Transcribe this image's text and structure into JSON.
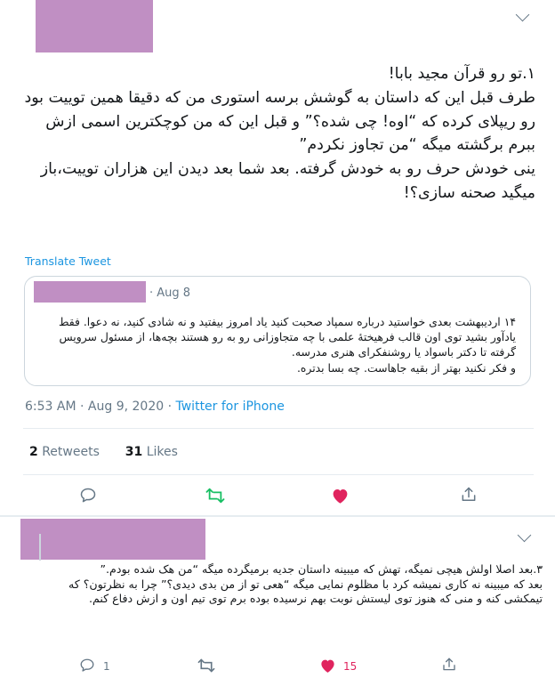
{
  "tweet": {
    "text": "١.تو رو قرآن مجید بابا!\nطرف قبل این که داستان به گوشش برسه استوری من که دقیقا همین توییت بود رو ریپلای کرده که “اوه! چی شده؟” و قبل این که من کوچکترین اسمی ازش ببرم برگشته میگه “من تجاوز نکردم”\nینی خودش حرف رو به خودش گرفته. بعد شما بعد دیدن این هزاران توییت،باز میگید صحنه سازی؟!",
    "translate_label": "Translate Tweet",
    "time": "6:53 AM",
    "date": "Aug 9, 2020",
    "source": "Twitter for iPhone",
    "separator": "·",
    "retweets_count": "2",
    "retweets_label": "Retweets",
    "likes_count": "31",
    "likes_label": "Likes"
  },
  "quote": {
    "date": "· Aug 8",
    "text": "۱۴ اردیبهشت بعدی خواستید درباره سمپاد صحبت کنید یاد امروز بیفتید و نه شادی کنید، نه دعوا. فقط یادآور بشید توی اون قالب فرهیختهٔ علمی با چه متجاوزانی رو به رو هستند بچه‌ها، از مسئول سرویس گرفته تا دکتر باسواد یا روشنفکرای هنری مدرسه.\nو فکر نکنید بهتر از بقیه جاهاست. چه بسا بدتره."
  },
  "reply": {
    "text": "۳.بعد اصلا اولش هیچی نمیگه، تهش که میبینه داستان جدیه برمیگرده میگه “من هک شده بودم.”\nبعد که میبینه نه کاری نمیشه کرد با مظلوم نمایی میگه “هعی تو از من بدی دیدی؟” چرا به نظرتون؟ که تیمکشی کنه و منی که هنوز توی لیستش نوبت بهم نرسیده بوده برم توی تیم اون و ازش دفاع کنم.",
    "reply_count": "1",
    "like_count": "15"
  },
  "colors": {
    "like_red": "#e0245e",
    "retweet_green": "#17bf63",
    "link_blue": "#1b95e0",
    "muted": "#657786",
    "redaction": "#c08fc3"
  }
}
